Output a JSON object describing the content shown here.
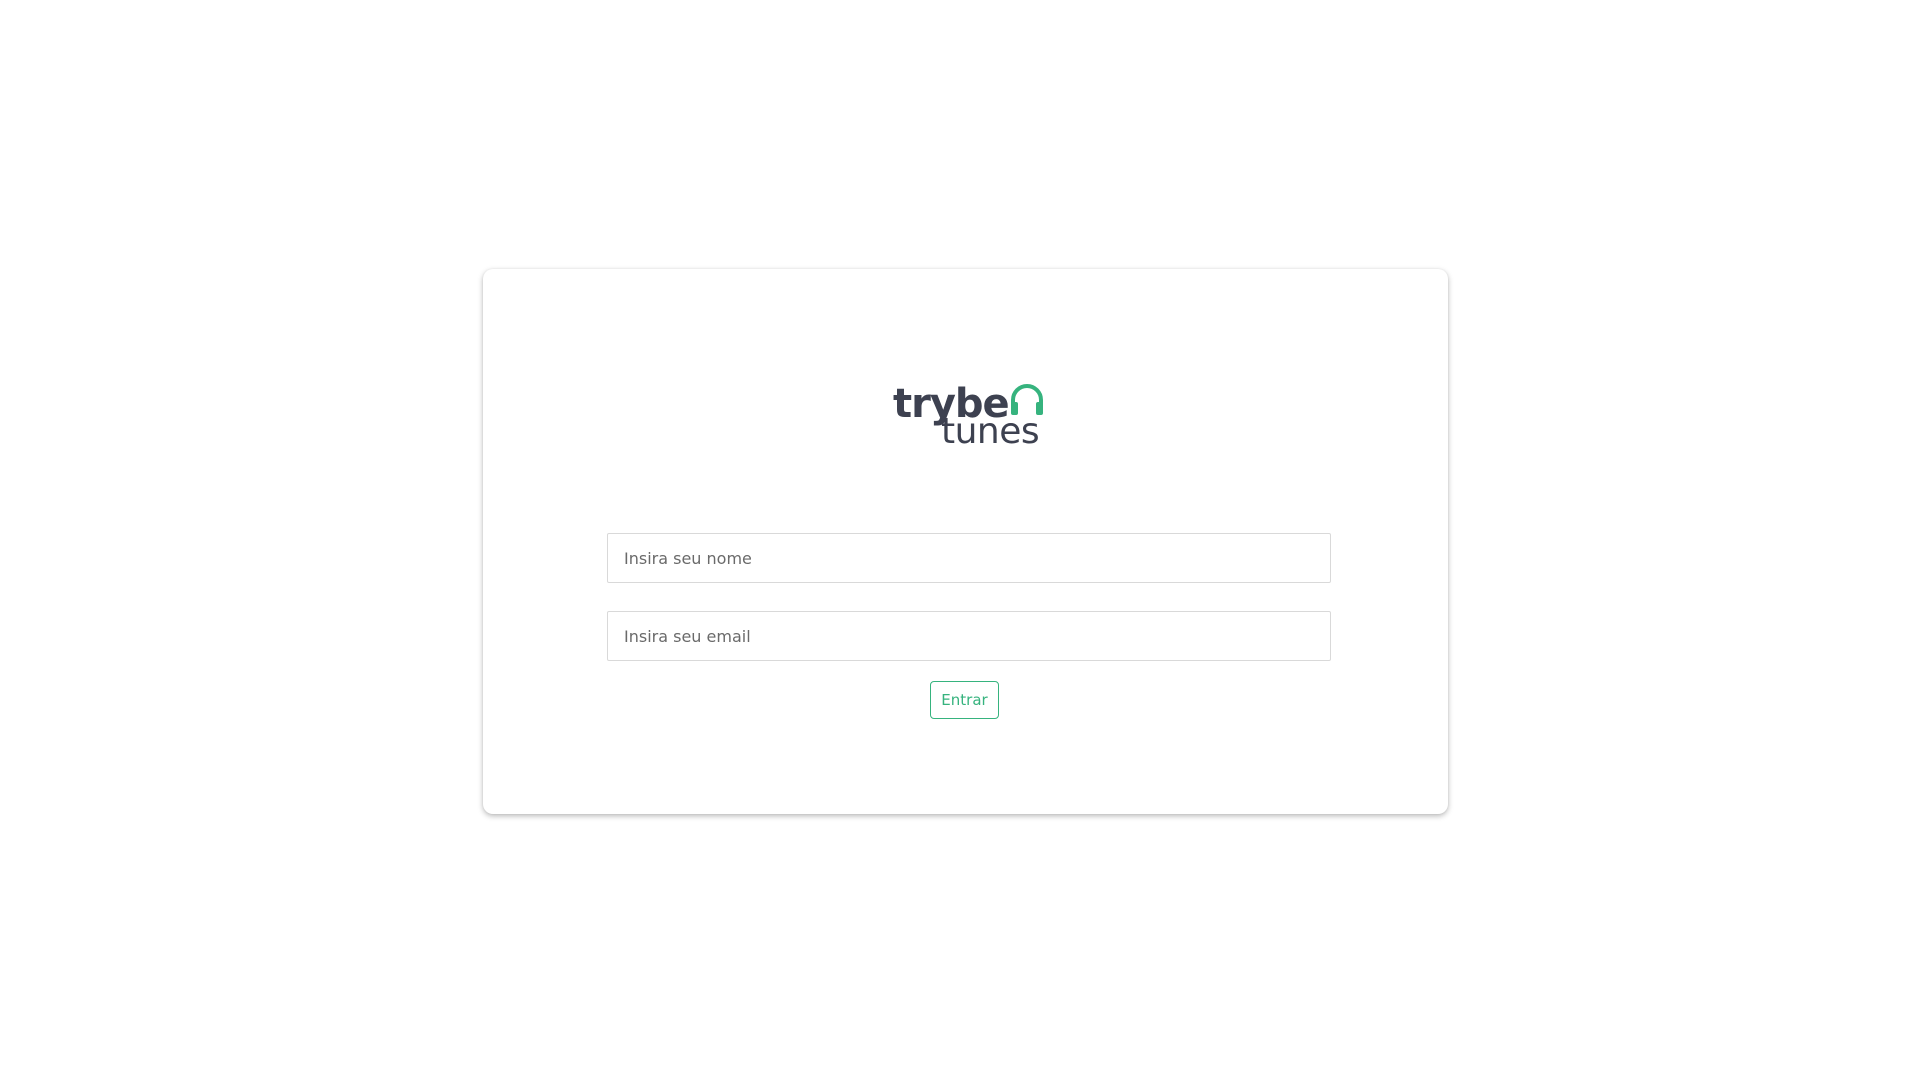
{
  "brand": {
    "name_primary": "trybe",
    "name_secondary": "tunes",
    "logo_icon": "headphones-icon",
    "text_color": "#3d4150",
    "accent_color": "#36b37e"
  },
  "login": {
    "name_input": {
      "placeholder": "Insira seu nome",
      "value": ""
    },
    "email_input": {
      "placeholder": "Insira seu email",
      "value": ""
    },
    "submit_label": "Entrar"
  }
}
